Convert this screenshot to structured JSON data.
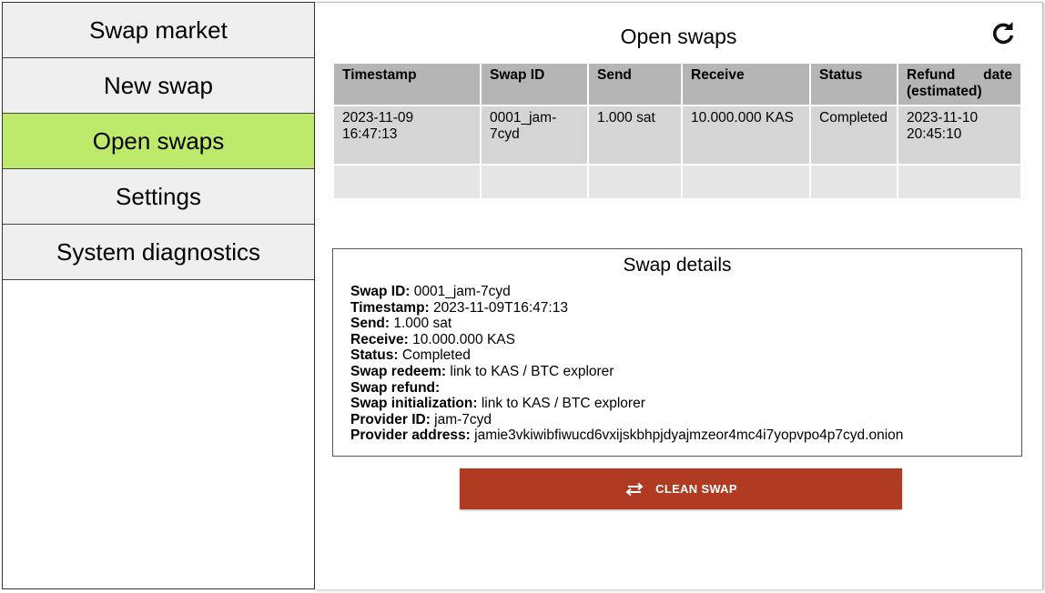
{
  "sidebar": {
    "items": [
      {
        "label": "Swap market"
      },
      {
        "label": "New swap"
      },
      {
        "label": "Open swaps"
      },
      {
        "label": "Settings"
      },
      {
        "label": "System diagnostics"
      }
    ],
    "active_index": 2
  },
  "main": {
    "title": "Open swaps",
    "refresh_icon": "refresh-icon"
  },
  "table": {
    "headers": {
      "timestamp": "Timestamp",
      "swap_id": "Swap ID",
      "send": "Send",
      "receive": "Receive",
      "status": "Status",
      "refund_date_line1": "Refund date",
      "refund_date_line2": "(estimated)"
    },
    "rows": [
      {
        "timestamp": "2023-11-09 16:47:13",
        "swap_id": "0001_jam-7cyd",
        "send": "1.000 sat",
        "receive": "10.000.000 KAS",
        "status": "Completed",
        "refund_date": "2023-11-10 20:45:10"
      }
    ]
  },
  "details": {
    "title": "Swap details",
    "fields": [
      {
        "label": "Swap ID:",
        "value": "0001_jam-7cyd"
      },
      {
        "label": "Timestamp:",
        "value": "2023-11-09T16:47:13"
      },
      {
        "label": "Send:",
        "value": "1.000 sat"
      },
      {
        "label": "Receive:",
        "value": "10.000.000 KAS"
      },
      {
        "label": "Status:",
        "value": "Completed"
      },
      {
        "label": "Swap redeem:",
        "value": "link to KAS / BTC explorer"
      },
      {
        "label": "Swap refund:",
        "value": ""
      },
      {
        "label": "Swap initialization:",
        "value": "link to KAS / BTC explorer"
      },
      {
        "label": "Provider ID:",
        "value": "jam-7cyd"
      },
      {
        "label": "Provider address:",
        "value": "jamie3vkiwibfiwucd6vxijskbhpjdyajmzeor4mc4i7yopvpo4p7cyd.onion"
      }
    ]
  },
  "actions": {
    "clean_swap_label": "CLEAN SWAP",
    "clean_swap_icon": "swap-arrows-icon",
    "clean_swap_color": "#b03a22"
  },
  "colors": {
    "active_nav": "#bdea6a",
    "nav_bg": "#efefef",
    "table_header": "#b5b5b5",
    "table_cell": "#d5d5d5"
  }
}
